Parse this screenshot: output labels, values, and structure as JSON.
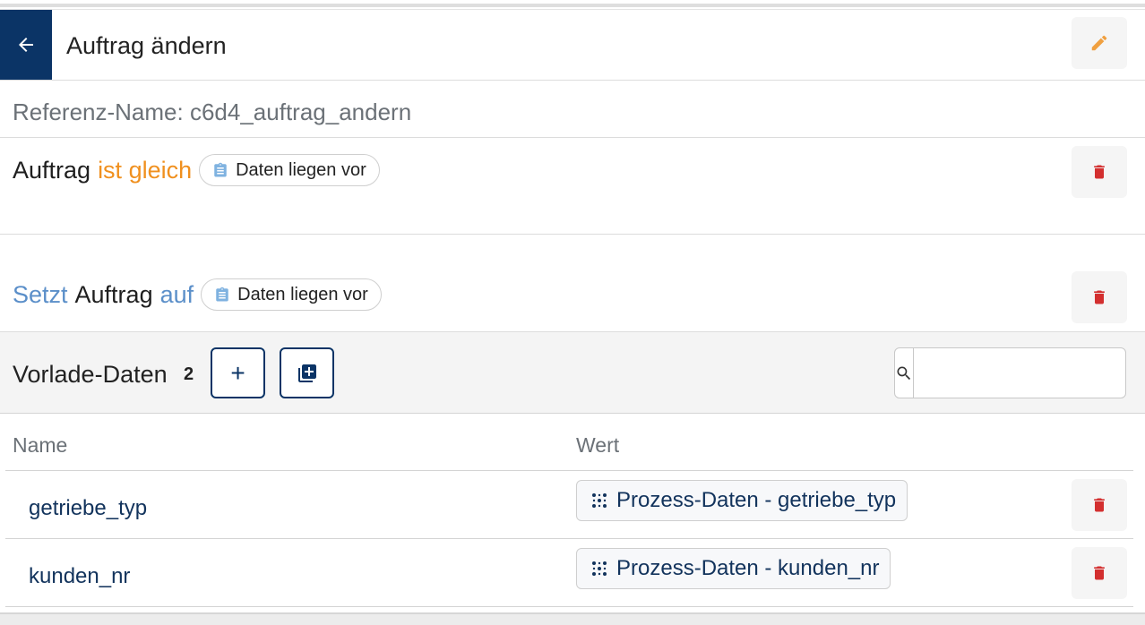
{
  "header": {
    "title": "Auftrag ändern",
    "back_icon": "arrow-left-icon",
    "edit_icon": "pencil-icon"
  },
  "reference": {
    "text": "Referenz-Name: c6d4_auftrag_andern"
  },
  "condition": {
    "subject": "Auftrag",
    "operator": "ist gleich",
    "value": "Daten liegen vor",
    "value_icon": "clipboard-icon"
  },
  "assignment": {
    "verb": "Setzt",
    "subject": "Auftrag",
    "preposition": "auf",
    "value": "Daten liegen vor",
    "value_icon": "clipboard-icon"
  },
  "vorlade": {
    "title": "Vorlade-Daten",
    "count": "2",
    "add_label": "+",
    "search_placeholder": "",
    "columns": {
      "name": "Name",
      "value": "Wert"
    },
    "rows": [
      {
        "name": "getriebe_typ",
        "value": "Prozess-Daten - getriebe_typ"
      },
      {
        "name": "kunden_nr",
        "value": "Prozess-Daten - kunden_nr"
      }
    ]
  },
  "colors": {
    "primary": "#0b3466",
    "operator": "#f0901e",
    "verb": "#5b8fc9",
    "delete": "#d32f2f",
    "edit": "#f0a040"
  }
}
